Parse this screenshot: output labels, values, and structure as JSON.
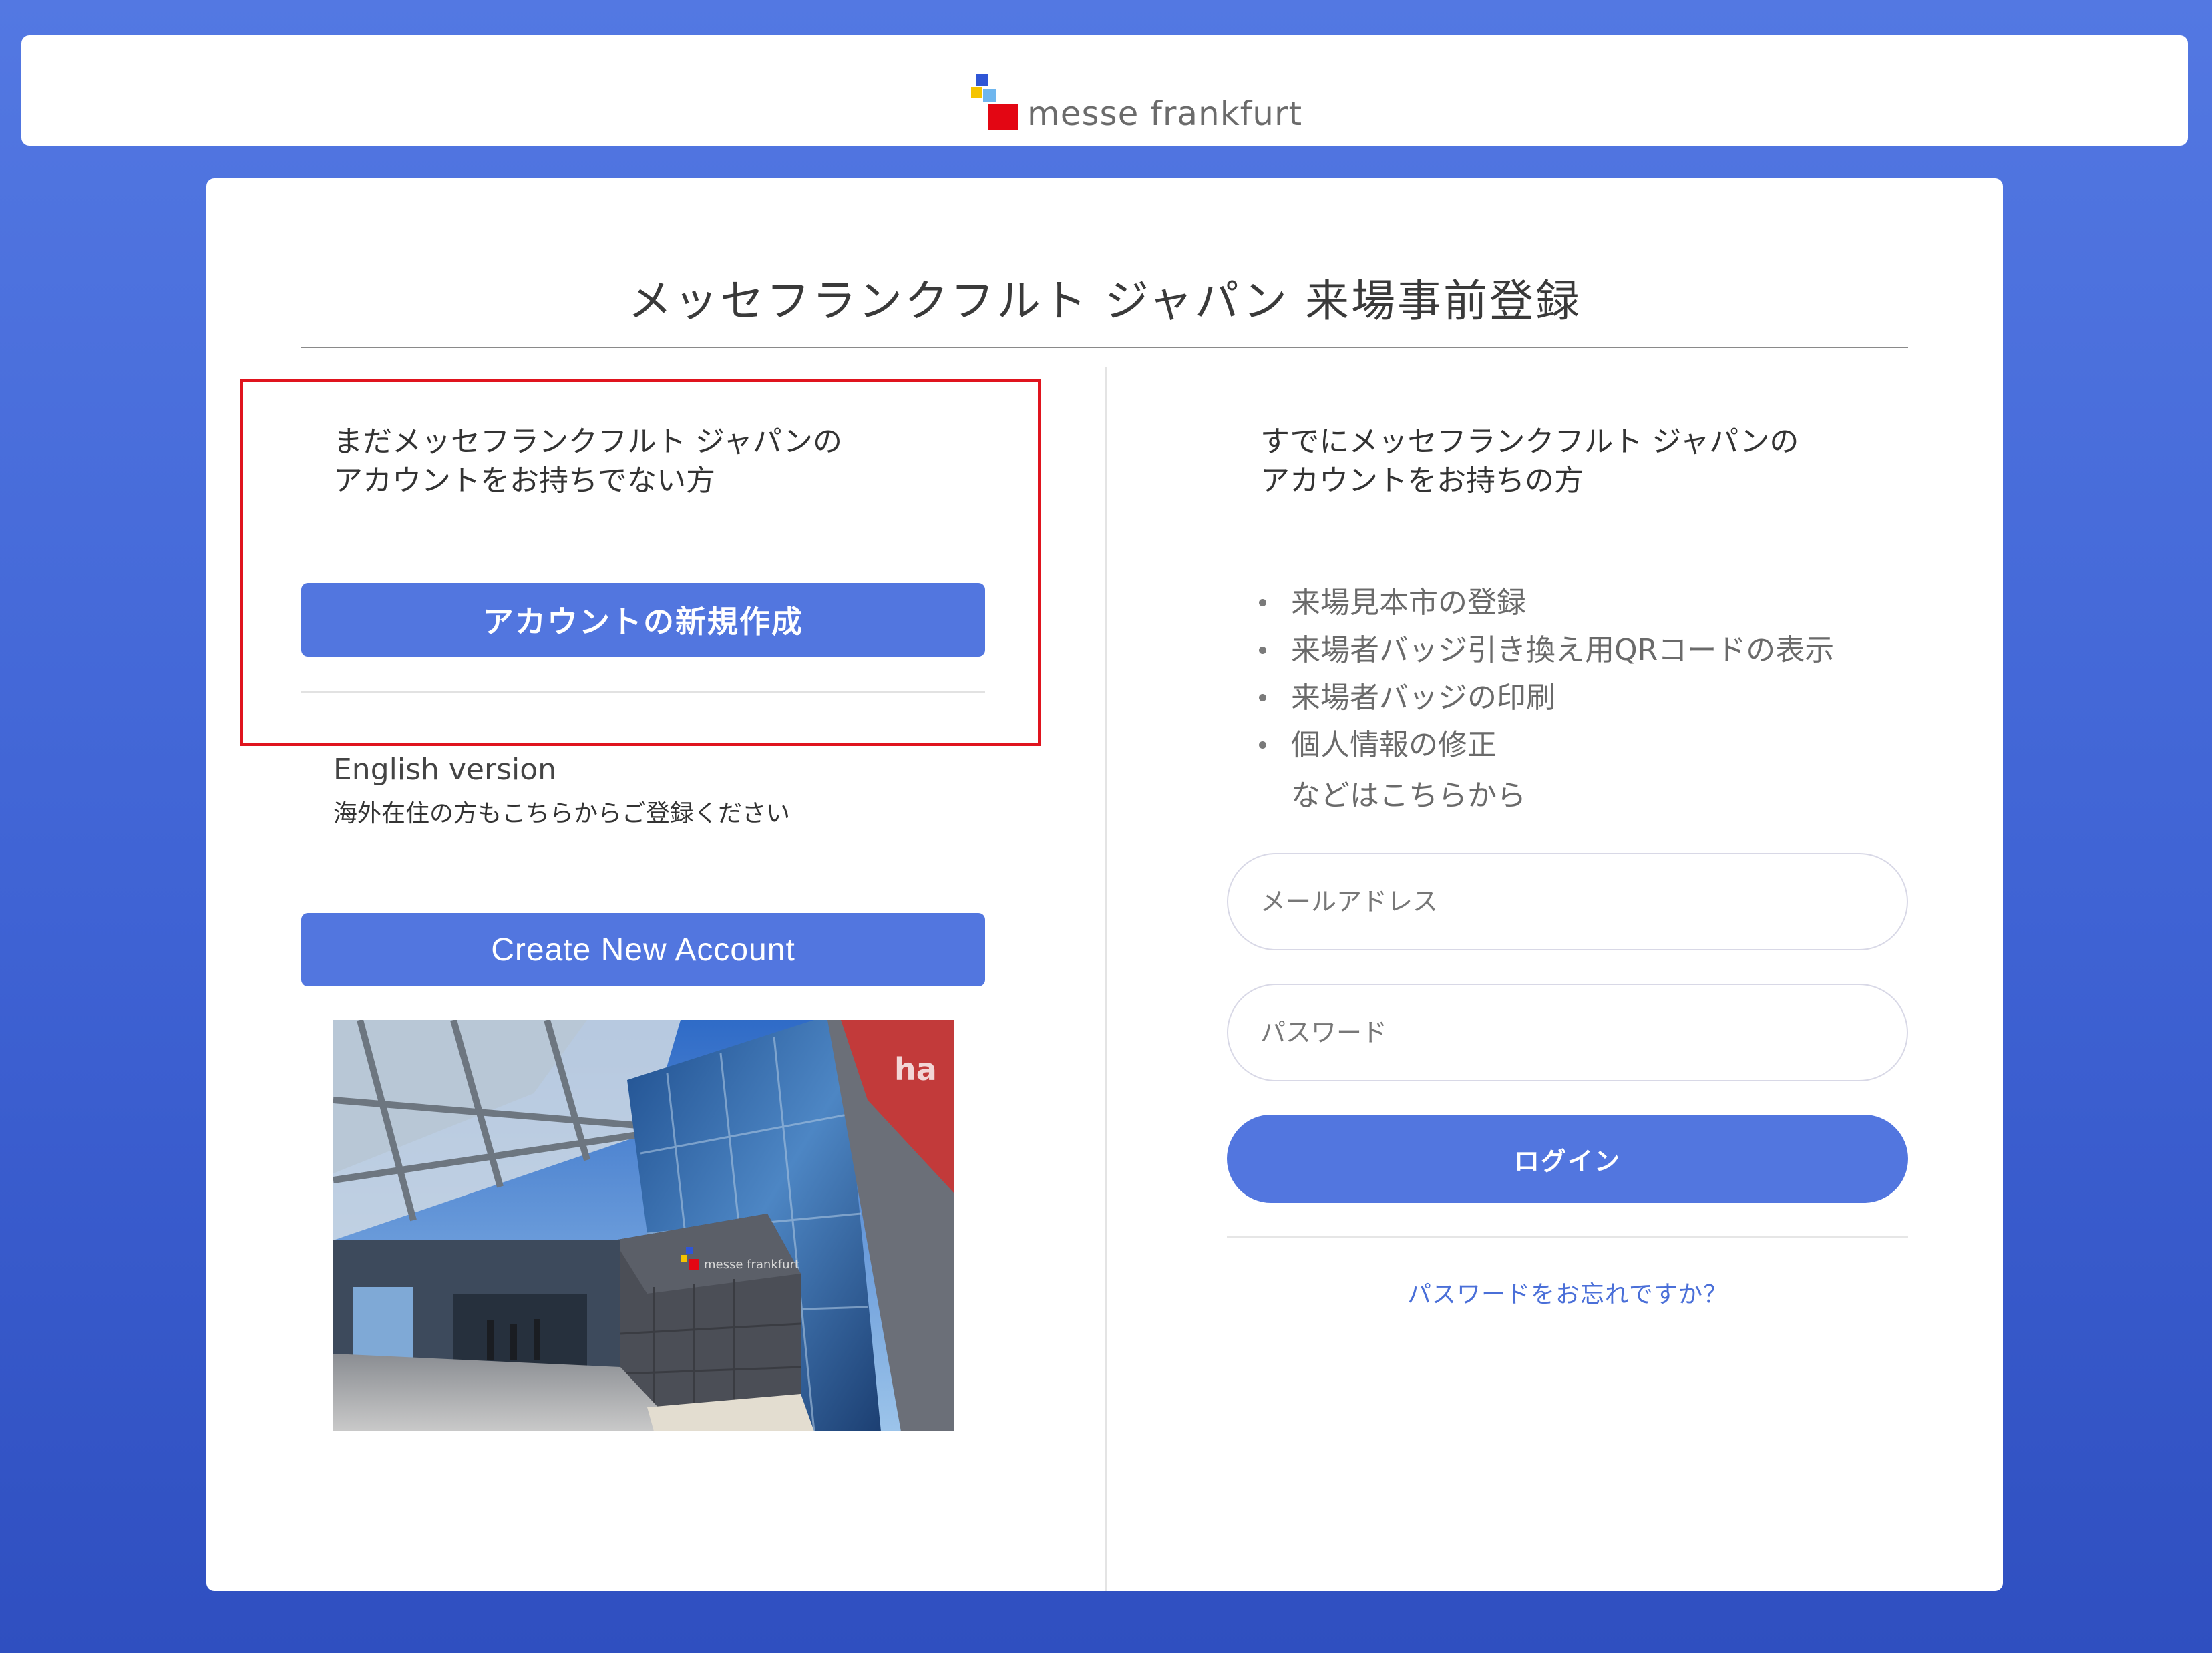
{
  "header": {
    "logo_text": "messe frankfurt"
  },
  "card": {
    "title": "メッセフランクフルト ジャパン 来場事前登録"
  },
  "left": {
    "intro_line1": "まだメッセフランクフルト ジャパンの",
    "intro_line2": "アカウントをお持ちでない方",
    "create_account_jp_label": "アカウントの新規作成",
    "english_label": "English version",
    "english_note": "海外在住の方もこちらからご登録ください",
    "create_account_en_label": "Create New Account"
  },
  "right": {
    "intro_line1": "すでにメッセフランクフルト ジャパンの",
    "intro_line2": "アカウントをお持ちの方",
    "features": [
      "来場見本市の登録",
      "来場者バッジ引き換え用QRコードの表示",
      "来場者バッジの印刷",
      "個人情報の修正"
    ],
    "features_tail": "などはこちらから",
    "email_placeholder": "メールアドレス",
    "password_placeholder": "パスワード",
    "login_label": "ログイン",
    "forgot_password": "パスワードをお忘れですか？"
  },
  "colors": {
    "background": "#4a6fdd",
    "accent": "#5276df",
    "highlight": "#e0141e",
    "link": "#4a6fd8"
  }
}
